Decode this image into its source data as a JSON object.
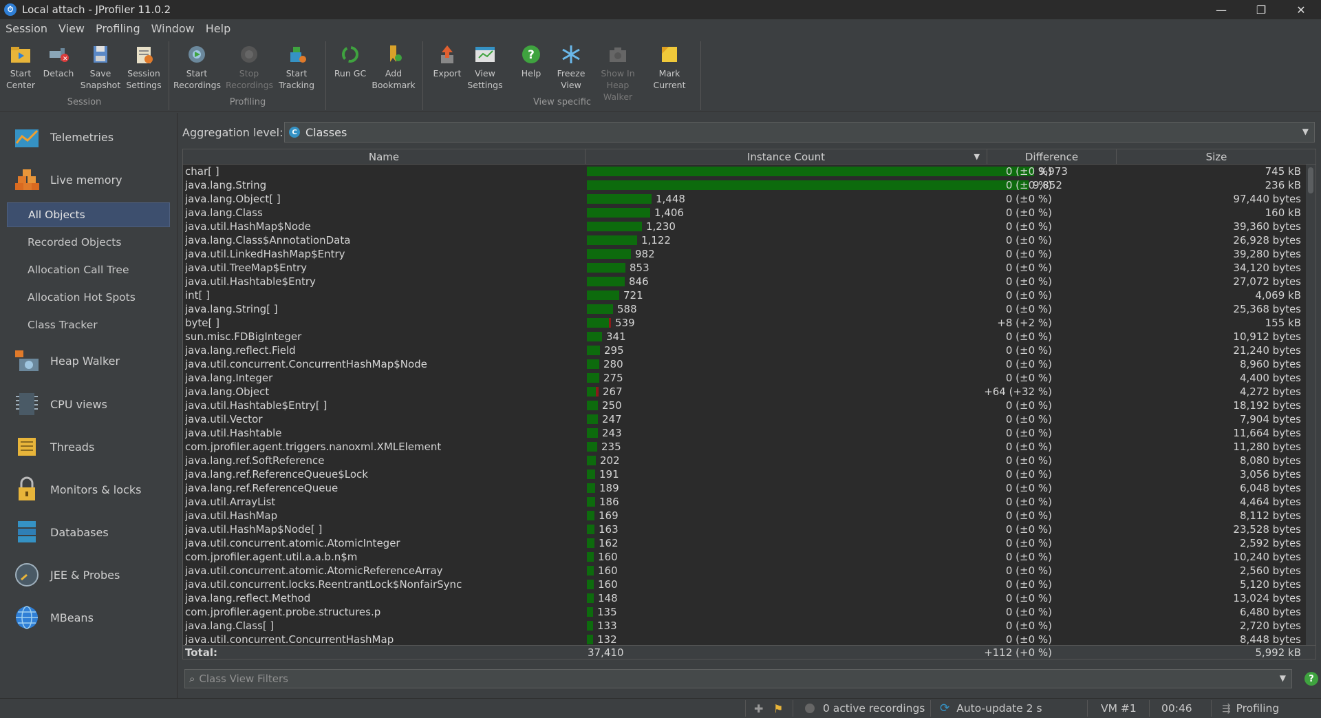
{
  "window": {
    "title": "Local attach - JProfiler 11.0.2",
    "minimize": "—",
    "maximize": "❐",
    "close": "✕"
  },
  "menu": [
    "Session",
    "View",
    "Profiling",
    "Window",
    "Help"
  ],
  "toolbar": {
    "groups": [
      {
        "label": "Session",
        "buttons": [
          {
            "name": "start-center-button",
            "label1": "Start",
            "label2": "Center",
            "icon": "folder-icon",
            "enabled": true
          },
          {
            "name": "detach-button",
            "label1": "Detach",
            "label2": "",
            "icon": "detach-icon",
            "enabled": true
          },
          {
            "name": "save-snapshot-button",
            "label1": "Save",
            "label2": "Snapshot",
            "icon": "save-icon",
            "enabled": true
          },
          {
            "name": "session-settings-button",
            "label1": "Session",
            "label2": "Settings",
            "icon": "settings-icon",
            "enabled": true
          }
        ]
      },
      {
        "label": "Profiling",
        "buttons": [
          {
            "name": "start-recordings-button",
            "label1": "Start",
            "label2": "Recordings",
            "icon": "recordings-icon",
            "enabled": true
          },
          {
            "name": "stop-recordings-button",
            "label1": "Stop",
            "label2": "Recordings",
            "icon": "stop-recordings-icon",
            "enabled": false
          },
          {
            "name": "start-tracking-button",
            "label1": "Start",
            "label2": "Tracking",
            "icon": "tracking-icon",
            "enabled": true
          }
        ]
      },
      {
        "label": "",
        "buttons": [
          {
            "name": "run-gc-button",
            "label1": "Run GC",
            "label2": "",
            "icon": "recycle-icon",
            "enabled": true
          },
          {
            "name": "add-bookmark-button",
            "label1": "Add",
            "label2": "Bookmark",
            "icon": "bookmark-icon",
            "enabled": true
          }
        ]
      },
      {
        "label": "View specific",
        "buttons": [
          {
            "name": "export-button",
            "label1": "Export",
            "label2": "",
            "icon": "export-icon",
            "enabled": true
          },
          {
            "name": "view-settings-button",
            "label1": "View",
            "label2": "Settings",
            "icon": "view-settings-icon",
            "enabled": true
          },
          {
            "name": "help-button",
            "label1": "Help",
            "label2": "",
            "icon": "help-icon",
            "enabled": true
          },
          {
            "name": "freeze-view-button",
            "label1": "Freeze",
            "label2": "View",
            "icon": "snowflake-icon",
            "enabled": true
          },
          {
            "name": "show-in-heap-walker-button",
            "label1": "Show In",
            "label2": "Heap Walker",
            "icon": "camera-icon",
            "enabled": false
          },
          {
            "name": "mark-current-button",
            "label1": "Mark",
            "label2": "Current",
            "icon": "mark-icon",
            "enabled": true
          }
        ]
      }
    ]
  },
  "sidebar": {
    "sections": [
      {
        "label": "Telemetries",
        "icon": "telemetries-icon"
      },
      {
        "label": "Live memory",
        "icon": "live-memory-icon"
      },
      {
        "label": "Heap Walker",
        "icon": "heap-walker-icon"
      },
      {
        "label": "CPU views",
        "icon": "cpu-icon"
      },
      {
        "label": "Threads",
        "icon": "threads-icon"
      },
      {
        "label": "Monitors & locks",
        "icon": "lock-icon"
      },
      {
        "label": "Databases",
        "icon": "database-icon"
      },
      {
        "label": "JEE & Probes",
        "icon": "probe-icon"
      },
      {
        "label": "MBeans",
        "icon": "globe-icon"
      }
    ],
    "live_memory_items": [
      "All Objects",
      "Recorded Objects",
      "Allocation Call Tree",
      "Allocation Hot Spots",
      "Class Tracker"
    ],
    "selected": "All Objects"
  },
  "aggregation": {
    "label": "Aggregation level:",
    "value": "Classes",
    "value_icon": "C"
  },
  "table": {
    "columns": [
      "Name",
      "Instance Count",
      "Difference",
      "Size"
    ],
    "max_count": 9973,
    "rows": [
      {
        "name": "char[ ]",
        "count": 9973,
        "count_label": "9,973",
        "diff": "0 (±0 %)",
        "size": "745 kB",
        "inc": 0
      },
      {
        "name": "java.lang.String",
        "count": 9852,
        "count_label": "9,852",
        "diff": "0 (±0 %)",
        "size": "236 kB",
        "inc": 0
      },
      {
        "name": "java.lang.Object[ ]",
        "count": 1448,
        "count_label": "1,448",
        "diff": "0 (±0 %)",
        "size": "97,440 bytes",
        "inc": 0
      },
      {
        "name": "java.lang.Class",
        "count": 1406,
        "count_label": "1,406",
        "diff": "0 (±0 %)",
        "size": "160 kB",
        "inc": 0
      },
      {
        "name": "java.util.HashMap$Node",
        "count": 1230,
        "count_label": "1,230",
        "diff": "0 (±0 %)",
        "size": "39,360 bytes",
        "inc": 0
      },
      {
        "name": "java.lang.Class$AnnotationData",
        "count": 1122,
        "count_label": "1,122",
        "diff": "0 (±0 %)",
        "size": "26,928 bytes",
        "inc": 0
      },
      {
        "name": "java.util.LinkedHashMap$Entry",
        "count": 982,
        "count_label": "982",
        "diff": "0 (±0 %)",
        "size": "39,280 bytes",
        "inc": 0
      },
      {
        "name": "java.util.TreeMap$Entry",
        "count": 853,
        "count_label": "853",
        "diff": "0 (±0 %)",
        "size": "34,120 bytes",
        "inc": 0
      },
      {
        "name": "java.util.Hashtable$Entry",
        "count": 846,
        "count_label": "846",
        "diff": "0 (±0 %)",
        "size": "27,072 bytes",
        "inc": 0
      },
      {
        "name": "int[ ]",
        "count": 721,
        "count_label": "721",
        "diff": "0 (±0 %)",
        "size": "4,069 kB",
        "inc": 0
      },
      {
        "name": "java.lang.String[ ]",
        "count": 588,
        "count_label": "588",
        "diff": "0 (±0 %)",
        "size": "25,368 bytes",
        "inc": 0
      },
      {
        "name": "byte[ ]",
        "count": 539,
        "count_label": "539",
        "diff": "+8 (+2 %)",
        "size": "155 kB",
        "inc": 8
      },
      {
        "name": "sun.misc.FDBigInteger",
        "count": 341,
        "count_label": "341",
        "diff": "0 (±0 %)",
        "size": "10,912 bytes",
        "inc": 0
      },
      {
        "name": "java.lang.reflect.Field",
        "count": 295,
        "count_label": "295",
        "diff": "0 (±0 %)",
        "size": "21,240 bytes",
        "inc": 0
      },
      {
        "name": "java.util.concurrent.ConcurrentHashMap$Node",
        "count": 280,
        "count_label": "280",
        "diff": "0 (±0 %)",
        "size": "8,960 bytes",
        "inc": 0
      },
      {
        "name": "java.lang.Integer",
        "count": 275,
        "count_label": "275",
        "diff": "0 (±0 %)",
        "size": "4,400 bytes",
        "inc": 0
      },
      {
        "name": "java.lang.Object",
        "count": 267,
        "count_label": "267",
        "diff": "+64 (+32 %)",
        "size": "4,272 bytes",
        "inc": 64
      },
      {
        "name": "java.util.Hashtable$Entry[ ]",
        "count": 250,
        "count_label": "250",
        "diff": "0 (±0 %)",
        "size": "18,192 bytes",
        "inc": 0
      },
      {
        "name": "java.util.Vector",
        "count": 247,
        "count_label": "247",
        "diff": "0 (±0 %)",
        "size": "7,904 bytes",
        "inc": 0
      },
      {
        "name": "java.util.Hashtable",
        "count": 243,
        "count_label": "243",
        "diff": "0 (±0 %)",
        "size": "11,664 bytes",
        "inc": 0
      },
      {
        "name": "com.jprofiler.agent.triggers.nanoxml.XMLElement",
        "count": 235,
        "count_label": "235",
        "diff": "0 (±0 %)",
        "size": "11,280 bytes",
        "inc": 0
      },
      {
        "name": "java.lang.ref.SoftReference",
        "count": 202,
        "count_label": "202",
        "diff": "0 (±0 %)",
        "size": "8,080 bytes",
        "inc": 0
      },
      {
        "name": "java.lang.ref.ReferenceQueue$Lock",
        "count": 191,
        "count_label": "191",
        "diff": "0 (±0 %)",
        "size": "3,056 bytes",
        "inc": 0
      },
      {
        "name": "java.lang.ref.ReferenceQueue",
        "count": 189,
        "count_label": "189",
        "diff": "0 (±0 %)",
        "size": "6,048 bytes",
        "inc": 0
      },
      {
        "name": "java.util.ArrayList",
        "count": 186,
        "count_label": "186",
        "diff": "0 (±0 %)",
        "size": "4,464 bytes",
        "inc": 0
      },
      {
        "name": "java.util.HashMap",
        "count": 169,
        "count_label": "169",
        "diff": "0 (±0 %)",
        "size": "8,112 bytes",
        "inc": 0
      },
      {
        "name": "java.util.HashMap$Node[ ]",
        "count": 163,
        "count_label": "163",
        "diff": "0 (±0 %)",
        "size": "23,528 bytes",
        "inc": 0
      },
      {
        "name": "java.util.concurrent.atomic.AtomicInteger",
        "count": 162,
        "count_label": "162",
        "diff": "0 (±0 %)",
        "size": "2,592 bytes",
        "inc": 0
      },
      {
        "name": "com.jprofiler.agent.util.a.a.b.n$m",
        "count": 160,
        "count_label": "160",
        "diff": "0 (±0 %)",
        "size": "10,240 bytes",
        "inc": 0
      },
      {
        "name": "java.util.concurrent.atomic.AtomicReferenceArray",
        "count": 160,
        "count_label": "160",
        "diff": "0 (±0 %)",
        "size": "2,560 bytes",
        "inc": 0
      },
      {
        "name": "java.util.concurrent.locks.ReentrantLock$NonfairSync",
        "count": 160,
        "count_label": "160",
        "diff": "0 (±0 %)",
        "size": "5,120 bytes",
        "inc": 0
      },
      {
        "name": "java.lang.reflect.Method",
        "count": 148,
        "count_label": "148",
        "diff": "0 (±0 %)",
        "size": "13,024 bytes",
        "inc": 0
      },
      {
        "name": "com.jprofiler.agent.probe.structures.p",
        "count": 135,
        "count_label": "135",
        "diff": "0 (±0 %)",
        "size": "6,480 bytes",
        "inc": 0
      },
      {
        "name": "java.lang.Class[ ]",
        "count": 133,
        "count_label": "133",
        "diff": "0 (±0 %)",
        "size": "2,720 bytes",
        "inc": 0
      },
      {
        "name": "java.util.concurrent.ConcurrentHashMap",
        "count": 132,
        "count_label": "132",
        "diff": "0 (±0 %)",
        "size": "8,448 bytes",
        "inc": 0
      }
    ],
    "total": {
      "label": "Total:",
      "count": "37,410",
      "diff": "+112 (+0 %)",
      "size": "5,992 kB"
    }
  },
  "filter": {
    "placeholder": "Class View Filters",
    "icon": "search-icon"
  },
  "status": {
    "recordings": "0 active recordings",
    "autoupdate": "Auto-update 2 s",
    "vm": "VM #1",
    "time": "00:46",
    "mode": "Profiling"
  },
  "colors": {
    "bar_green": "#0d6b0d",
    "bar_red": "#8b1a1a",
    "selection": "#3d4f6e",
    "background": "#3c3f41",
    "table_bg": "#2b2b2b"
  }
}
